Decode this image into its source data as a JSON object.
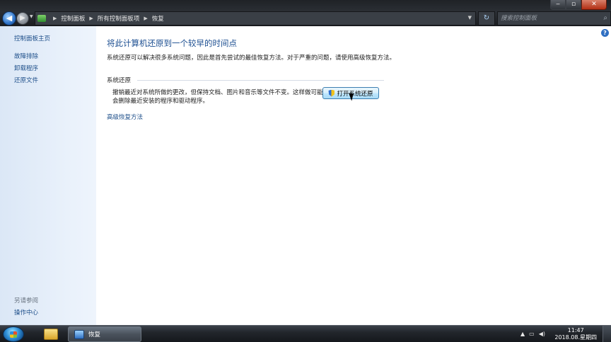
{
  "window": {
    "caption": {
      "minimize": "‒",
      "maximize": "▫",
      "close": "✕"
    }
  },
  "address": {
    "crumbs": [
      "控制面板",
      "所有控制面板项",
      "恢复"
    ],
    "search_placeholder": "搜索控制面板"
  },
  "sidebar": {
    "items": [
      "控制面板主页",
      "故障排除",
      "卸载程序",
      "还原文件"
    ],
    "see_also_heading": "另请参阅",
    "see_also_items": [
      "操作中心"
    ]
  },
  "main": {
    "title": "将此计算机还原到一个较早的时间点",
    "intro": "系统还原可以解决很多系统问题，因此是首先尝试的最佳恢复方法。对于严重的问题，请使用高级恢复方法。",
    "group_title": "系统还原",
    "group_desc": "撤销最近对系统所做的更改，但保持文档、图片和音乐等文件不变。这样做可能会删除最近安装的程序和驱动程序。",
    "restore_button": "打开系统还原",
    "advanced_link": "高级恢复方法",
    "help": "?"
  },
  "taskbar": {
    "task_label": "恢复",
    "clock_time": "11:47",
    "clock_date": "2018.08.星期四"
  },
  "icons": [
    "back-arrow-icon",
    "forward-arrow-icon",
    "control-panel-icon",
    "refresh-icon",
    "search-icon",
    "help-icon",
    "shield-icon",
    "cursor-icon",
    "windows-logo-icon",
    "folder-icon",
    "network-icon",
    "volume-icon"
  ]
}
